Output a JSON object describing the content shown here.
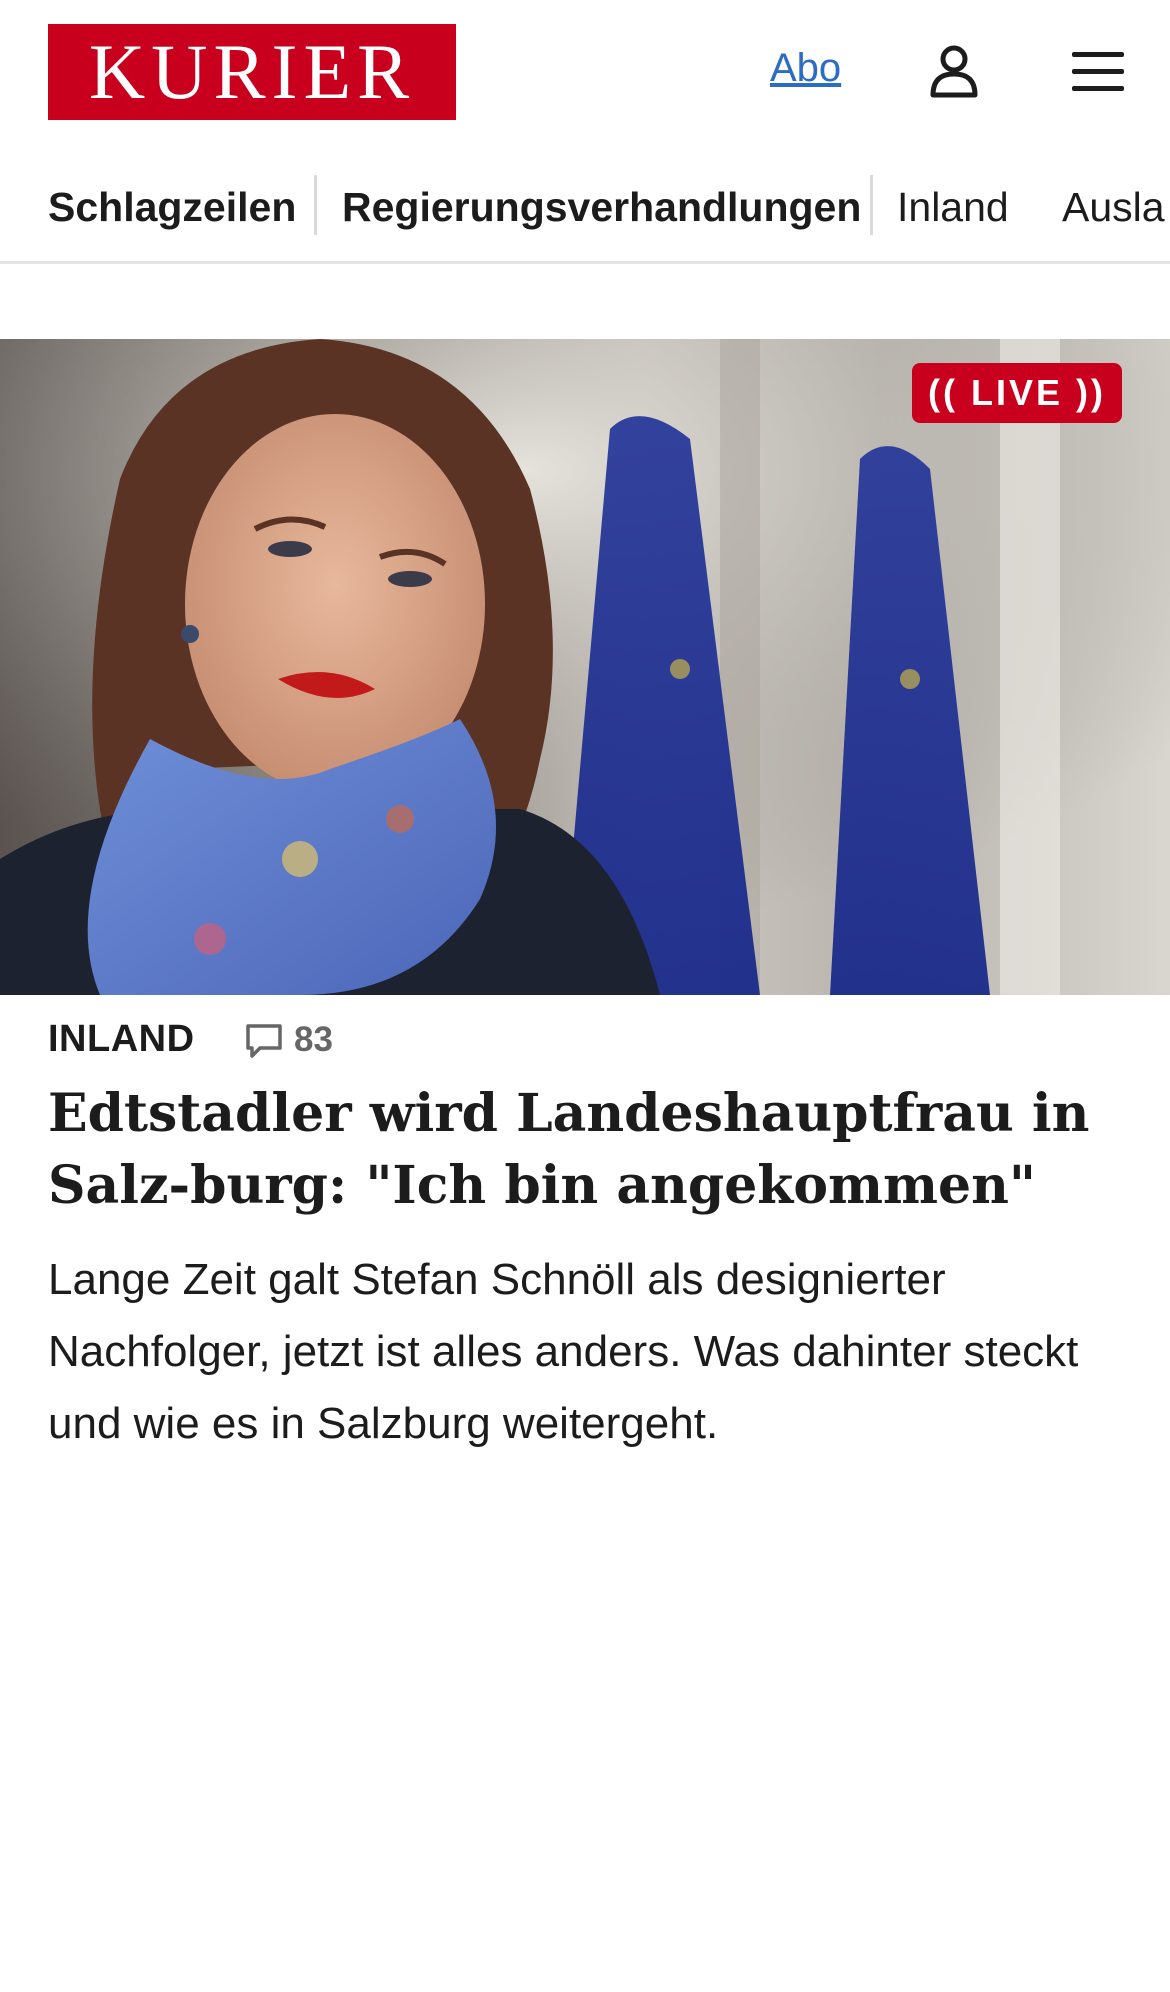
{
  "header": {
    "logo_text": "KURIER",
    "abo_label": "Abo",
    "user_icon": "user-icon",
    "menu_icon": "hamburger-menu-icon"
  },
  "nav": {
    "items": [
      {
        "label": "Schlagzeilen"
      },
      {
        "label": "Regierungsverhandlungen"
      },
      {
        "label": "Inland"
      },
      {
        "label": "Ausla"
      }
    ]
  },
  "article": {
    "image_icon": "photo",
    "live_label": "LIVE",
    "category": "INLAND",
    "comment_icon": "comment-icon",
    "comment_count": "83",
    "headline": "Edtstadler wird Landeshauptfrau in Salz-burg: \"Ich bin angekommen\"",
    "teaser": "Lange Zeit galt Stefan Schnöll als designierter Nachfolger, jetzt ist alles anders. Was dahinter steckt und wie es in Salzburg weitergeht."
  },
  "colors": {
    "brand_red": "#c8001e",
    "link_blue": "#2b6cc4",
    "text": "#1c1c1c",
    "muted": "#666666"
  }
}
